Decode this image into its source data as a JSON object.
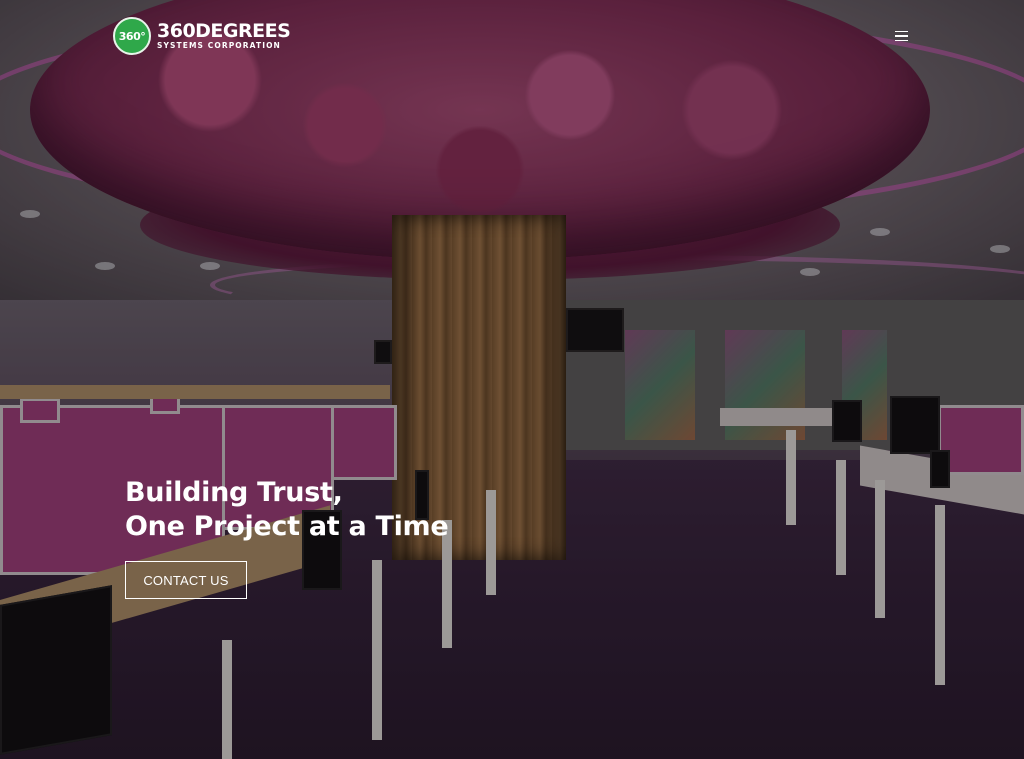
{
  "header": {
    "logo": {
      "badge_text": "360°",
      "name": "360DEGREES",
      "tagline": "SYSTEMS CORPORATION"
    },
    "menu_icon": "hamburger-menu-icon"
  },
  "hero": {
    "title_line1": "Building Trust,",
    "title_line2": "One Project at a Time",
    "cta_label": "CONTACT US",
    "background": "office-interior-with-pink-flower-tree"
  },
  "colors": {
    "brand_green": "#2fa84a",
    "text": "#ffffff",
    "accent_pink": "#9a3e78"
  }
}
